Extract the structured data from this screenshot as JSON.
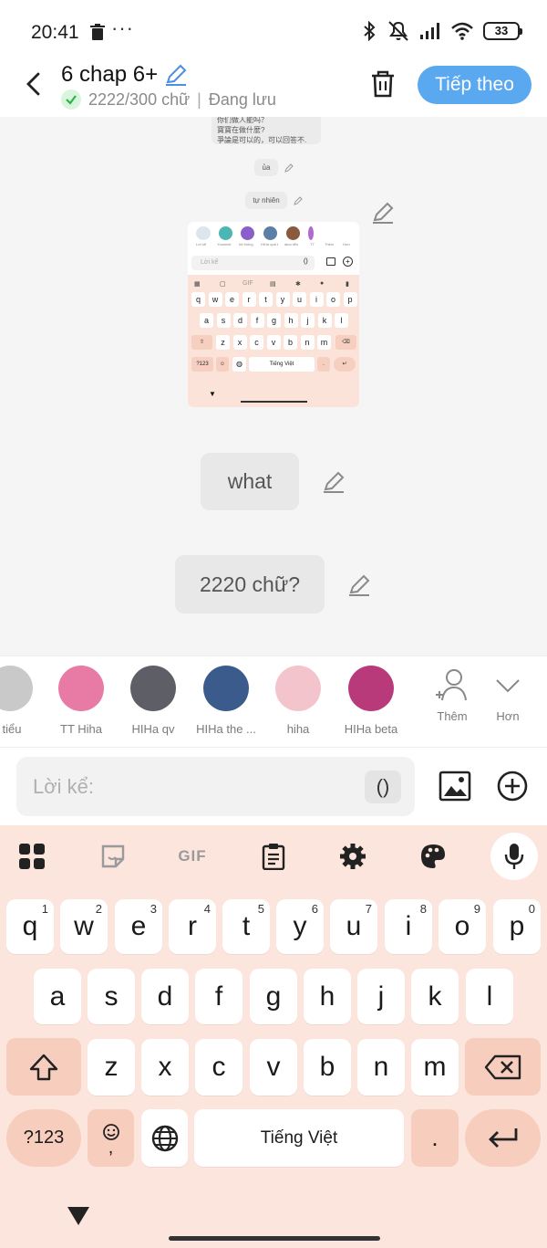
{
  "status": {
    "time": "20:41",
    "dots": "···",
    "battery": "33"
  },
  "header": {
    "title": "6 chap 6+",
    "counter": "2222/300 chữ",
    "separator": "|",
    "saving": "Đang lưu",
    "next_label": "Tiếp theo"
  },
  "chat": {
    "tiny_lines": [
      "你们做人能吗？",
      "寶寶在做什麼?",
      "爭論是可以的，可以回答不."
    ],
    "tiny_ua": "ủa",
    "tiny_tunhien": "tự nhiên",
    "bubble1": "what",
    "bubble2": "2220 chữ?"
  },
  "mini": {
    "input": "Lời kể",
    "paren": "()",
    "space": "Tiếng Việt",
    "row1": [
      "q",
      "w",
      "e",
      "r",
      "t",
      "y",
      "u",
      "i",
      "o",
      "p"
    ],
    "row2": [
      "a",
      "s",
      "d",
      "f",
      "g",
      "h",
      "j",
      "k",
      "l"
    ],
    "row3": [
      "z",
      "x",
      "c",
      "v",
      "b",
      "n",
      "m"
    ],
    "sym": "?123",
    "gif": "GIF",
    "labels": [
      "Lời kể",
      "Yuumeki",
      "hệ thống",
      "HIHa quả t",
      "lana tiểu",
      "TT",
      "Thêm",
      "Hơn"
    ]
  },
  "avatars": [
    {
      "label": "tiểu",
      "color": "#c9c9c9"
    },
    {
      "label": "TT Hiha",
      "color": "#e87aa6"
    },
    {
      "label": "HIHa qv",
      "color": "#5e5e66"
    },
    {
      "label": "HIHa the ...",
      "color": "#3a5b8c"
    },
    {
      "label": "hiha",
      "color": "#f4c4cc"
    },
    {
      "label": "HIHa beta",
      "color": "#b83a7a"
    }
  ],
  "avatar_actions": {
    "add_label": "Thêm",
    "more_label": "Hơn"
  },
  "input": {
    "placeholder": "Lời kể:",
    "paren": "()"
  },
  "keyboard": {
    "gif": "GIF",
    "row1": [
      {
        "k": "q",
        "n": "1"
      },
      {
        "k": "w",
        "n": "2"
      },
      {
        "k": "e",
        "n": "3"
      },
      {
        "k": "r",
        "n": "4"
      },
      {
        "k": "t",
        "n": "5"
      },
      {
        "k": "y",
        "n": "6"
      },
      {
        "k": "u",
        "n": "7"
      },
      {
        "k": "i",
        "n": "8"
      },
      {
        "k": "o",
        "n": "9"
      },
      {
        "k": "p",
        "n": "0"
      }
    ],
    "row2": [
      "a",
      "s",
      "d",
      "f",
      "g",
      "h",
      "j",
      "k",
      "l"
    ],
    "row3": [
      "z",
      "x",
      "c",
      "v",
      "b",
      "n",
      "m"
    ],
    "symbols": "?123",
    "emoji_comma": ",",
    "space": "Tiếng Việt",
    "period": "."
  },
  "colors": {
    "accent": "#5aa8f0",
    "keyboard_bg": "#fbe5dc",
    "special_key": "#f7cdbd"
  }
}
